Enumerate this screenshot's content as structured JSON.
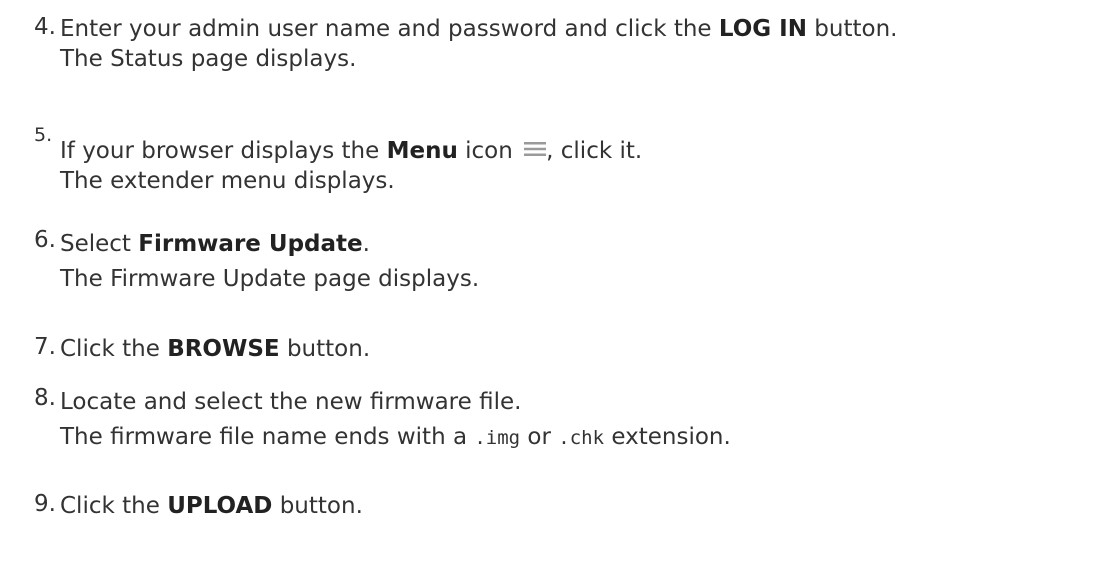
{
  "steps": [
    {
      "number": "4.",
      "pre": "Enter your admin user name and password and click the ",
      "bold": "LOG IN",
      "post": " button.",
      "result": "The Status page displays."
    },
    {
      "number": "5.",
      "pre": "If your browser displays the ",
      "bold": "Menu",
      "mid": " icon ",
      "icon": "menu-icon",
      "post": ", click it.",
      "result": "The extender menu displays."
    },
    {
      "number": "6.",
      "pre": "Select ",
      "bold": "Firmware Update",
      "post": ".",
      "result": "The Firmware Update page displays."
    },
    {
      "number": "7.",
      "pre": "Click the ",
      "bold": "BROWSE",
      "post": " button."
    },
    {
      "number": "8.",
      "text": "Locate and select the new firmware file.",
      "result_pre": "The firmware file name ends with a ",
      "ext1": ".img",
      "result_mid": " or ",
      "ext2": ".chk",
      "result_post": " extension."
    },
    {
      "number": "9.",
      "pre": "Click the ",
      "bold": "UPLOAD",
      "post": " button."
    }
  ],
  "colors": {
    "text": "#333333",
    "icon": "#9a9a9a"
  }
}
